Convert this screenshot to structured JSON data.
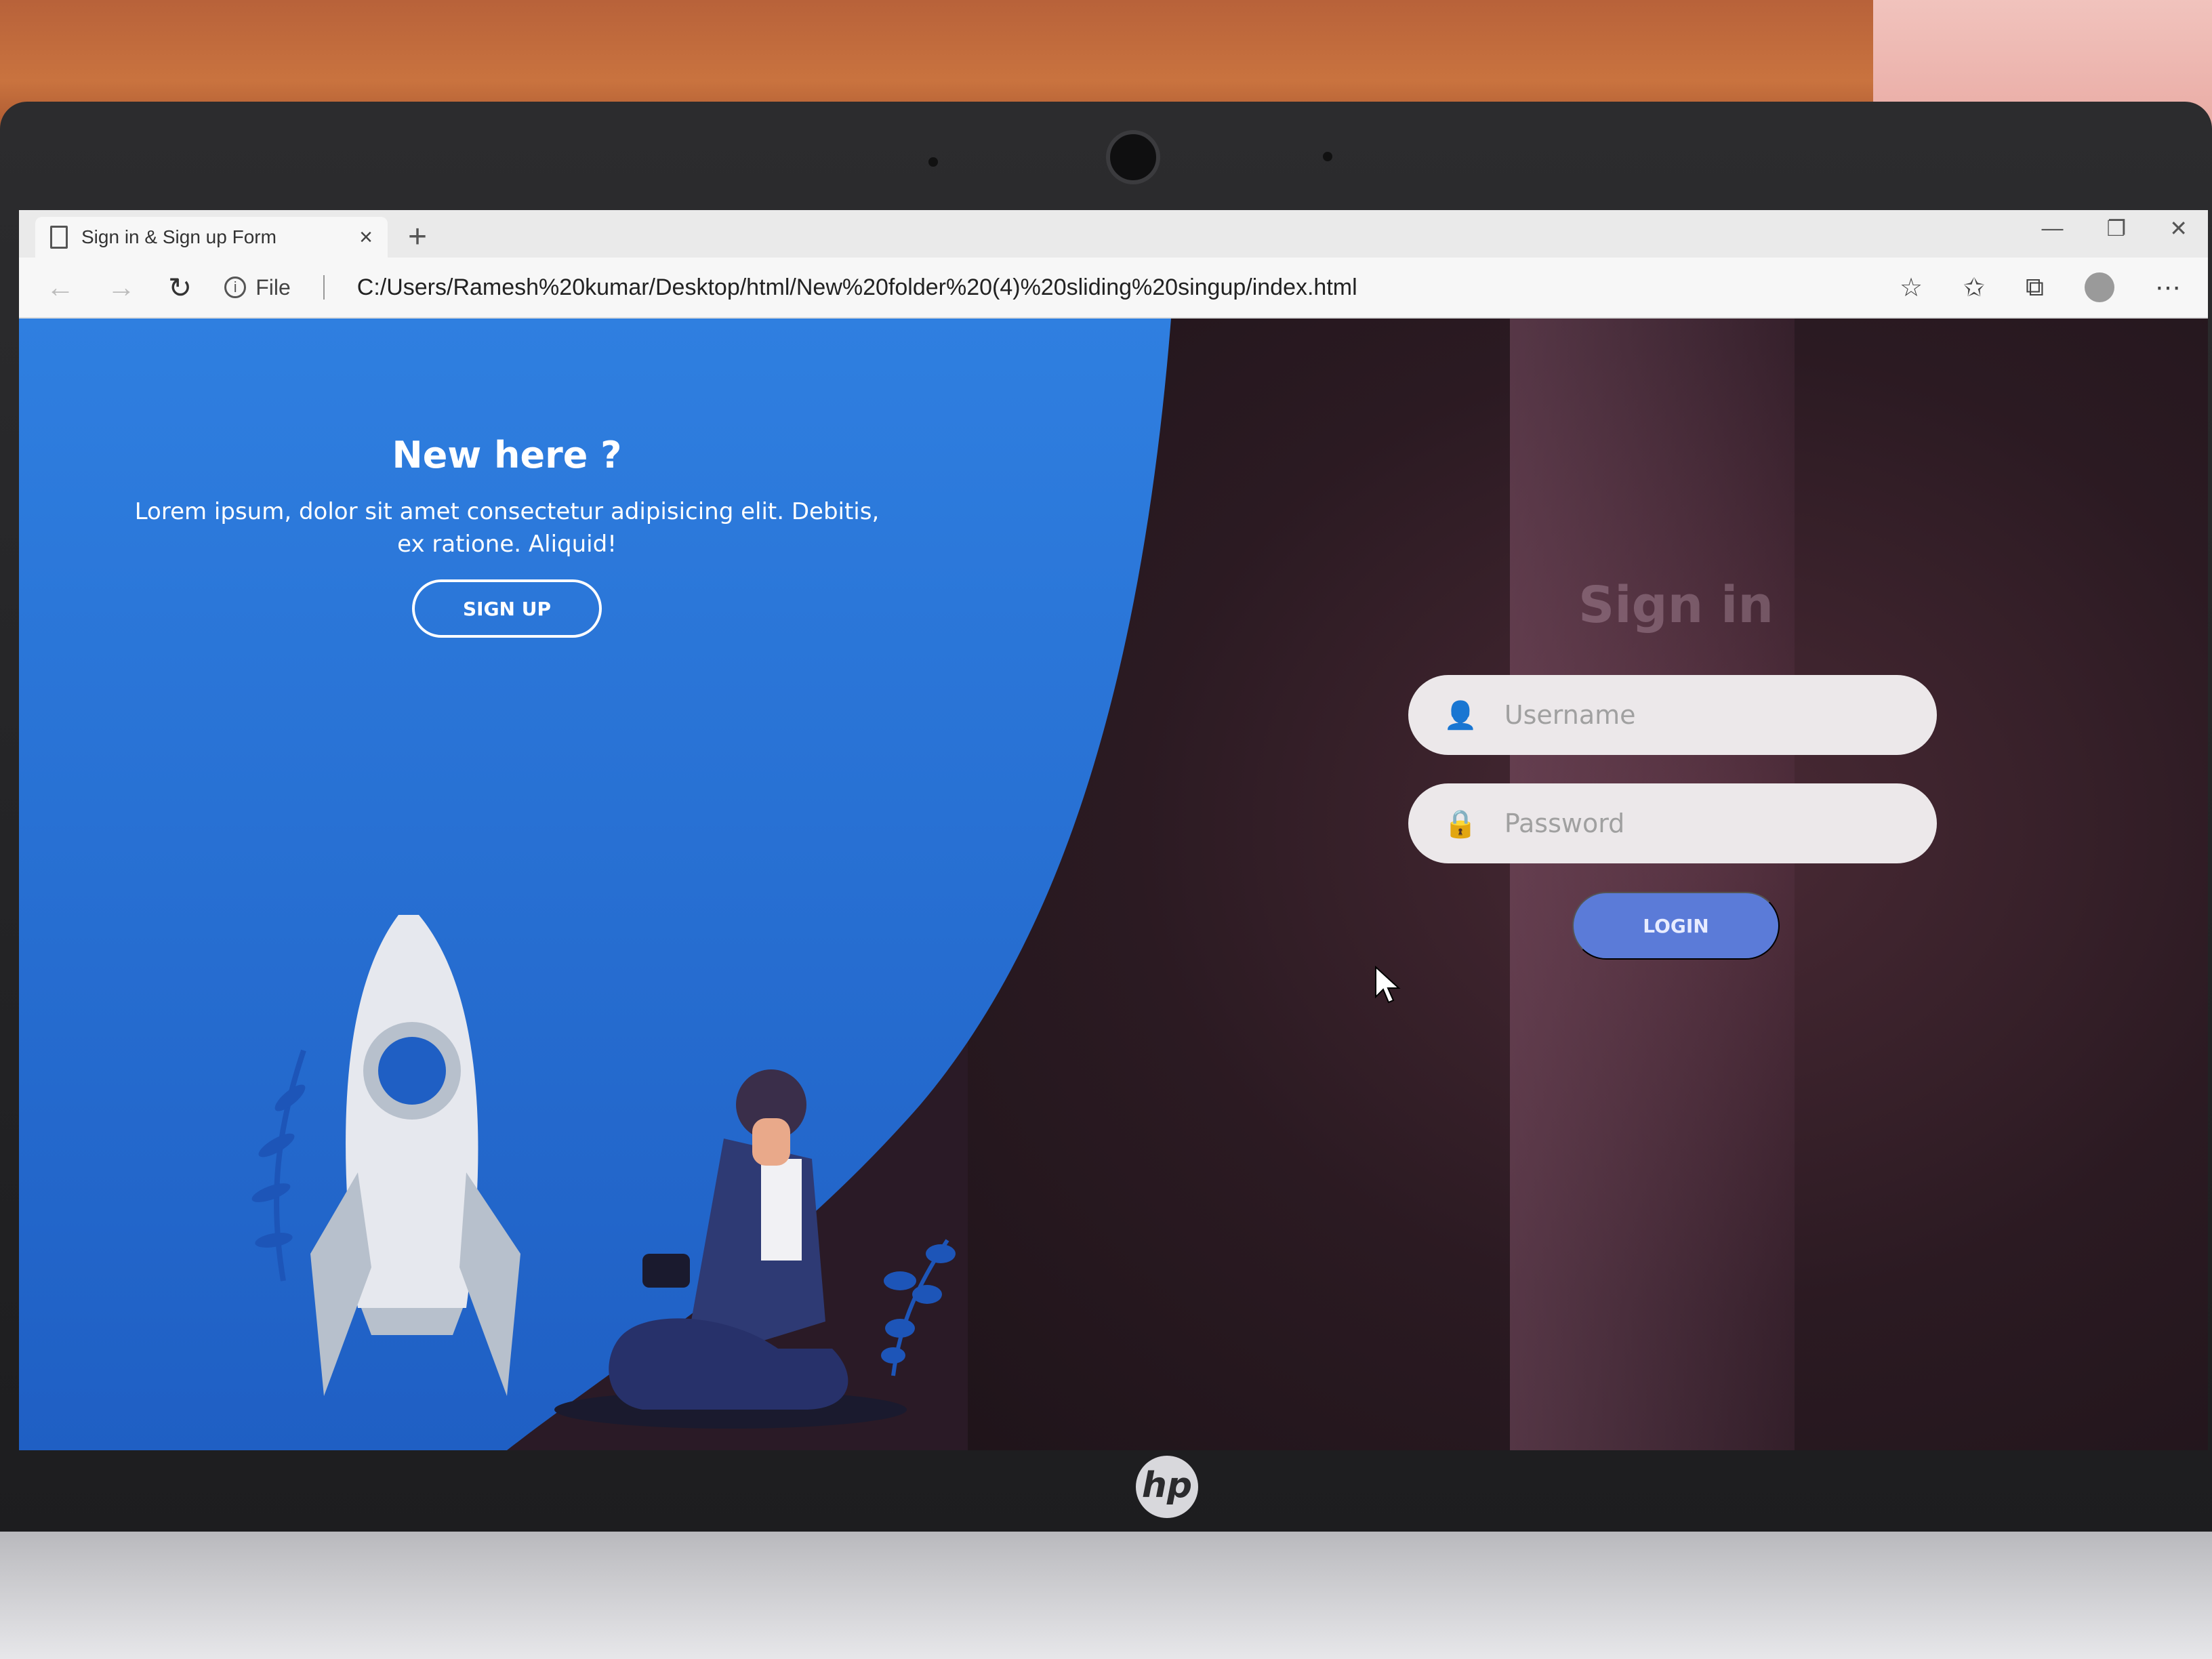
{
  "browser": {
    "tab_title": "Sign in & Sign up Form",
    "tab_close": "×",
    "new_tab": "+",
    "window_controls": [
      "—",
      "❐",
      "✕"
    ],
    "file_label": "File",
    "url": "C:/Users/Ramesh%20kumar/Desktop/html/New%20folder%20(4)%20sliding%20singup/index.html"
  },
  "signup_panel": {
    "heading": "New here ?",
    "description": "Lorem ipsum, dolor sit amet consectetur adipisicing elit. Debitis, ex ratione. Aliquid!",
    "button": "SIGN UP"
  },
  "signin_panel": {
    "title": "Sign in",
    "username_placeholder": "Username",
    "password_placeholder": "Password",
    "button": "LOGIN"
  },
  "laptop": {
    "brand": "hp"
  },
  "colors": {
    "accent_blue": "#2f7fe0",
    "login_button": "#5b7bd8",
    "dark_panel": "#2a1a26"
  }
}
